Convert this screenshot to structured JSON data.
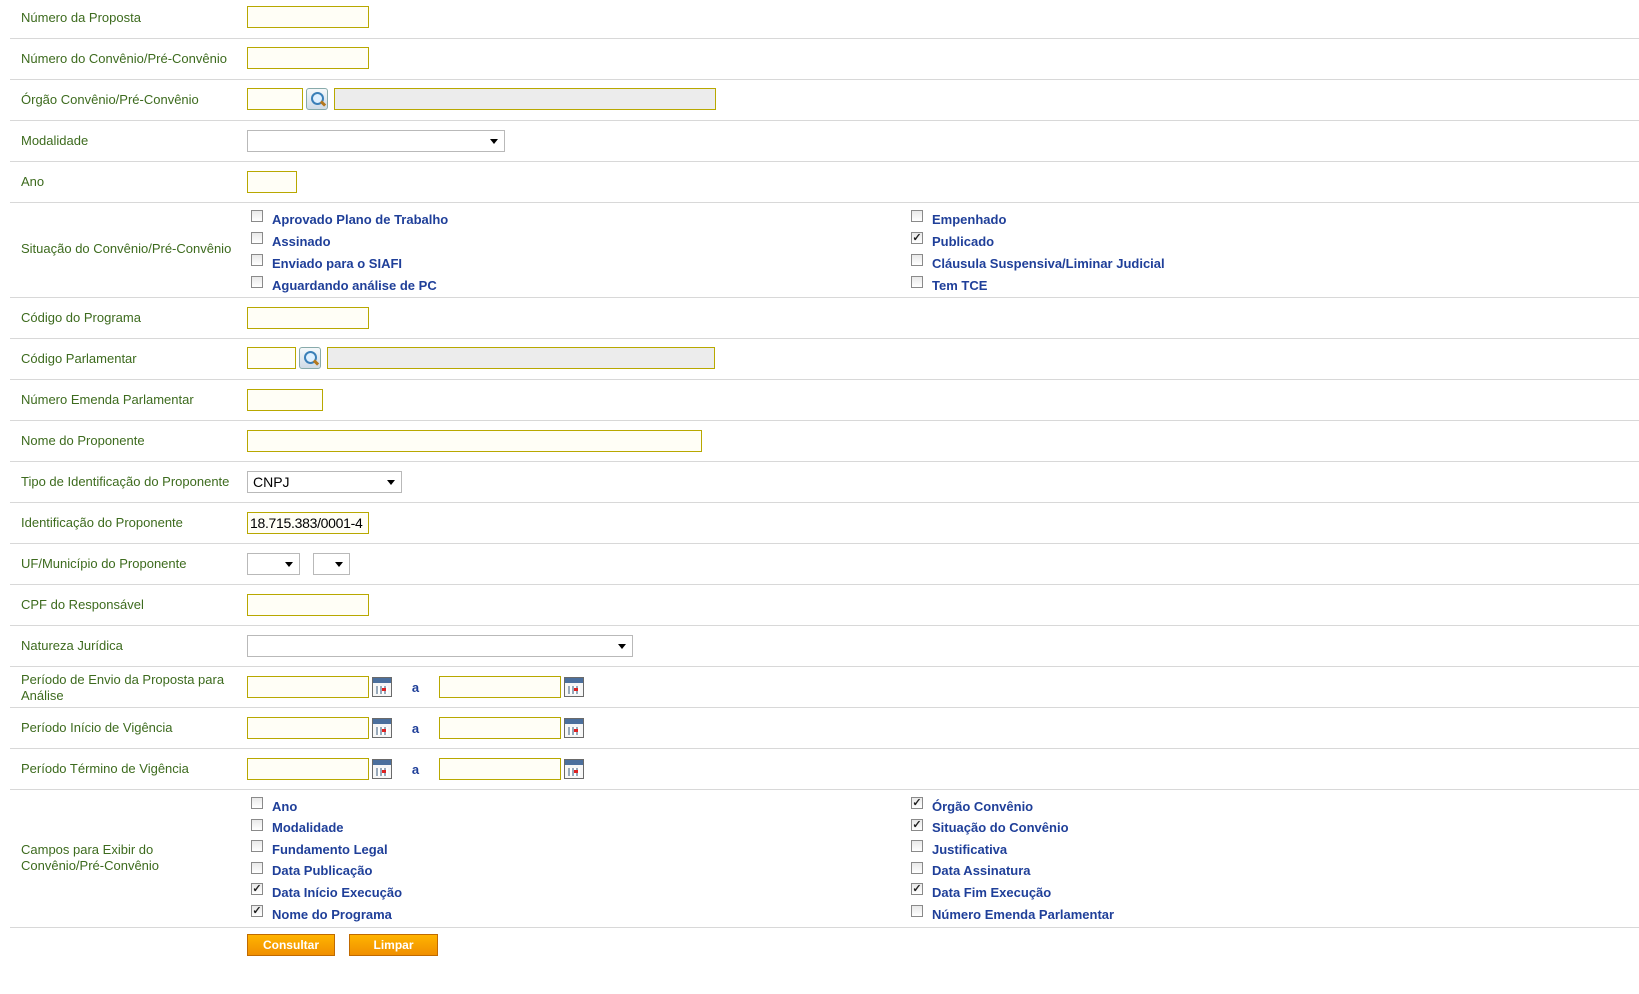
{
  "fields": {
    "numero_proposta": {
      "label": "Número da Proposta",
      "value": ""
    },
    "numero_convenio": {
      "label": "Número do Convênio/Pré-Convênio",
      "value": ""
    },
    "orgao": {
      "label": "Órgão Convênio/Pré-Convênio",
      "code": "",
      "name": ""
    },
    "modalidade": {
      "label": "Modalidade",
      "selected": ""
    },
    "ano": {
      "label": "Ano",
      "value": ""
    },
    "situacao": {
      "label": "Situação do Convênio/Pré-Convênio",
      "options": [
        {
          "label": "Aprovado Plano de Trabalho",
          "checked": false
        },
        {
          "label": "Assinado",
          "checked": false
        },
        {
          "label": "Enviado para o SIAFI",
          "checked": false
        },
        {
          "label": "Aguardando análise de PC",
          "checked": false
        },
        {
          "label": "Empenhado",
          "checked": false
        },
        {
          "label": "Publicado",
          "checked": true
        },
        {
          "label": "Cláusula Suspensiva/Liminar Judicial",
          "checked": false
        },
        {
          "label": "Tem TCE",
          "checked": false
        }
      ]
    },
    "codigo_programa": {
      "label": "Código do Programa",
      "value": ""
    },
    "codigo_parlamentar": {
      "label": "Código Parlamentar",
      "code": "",
      "name": ""
    },
    "numero_emenda": {
      "label": "Número Emenda Parlamentar",
      "value": ""
    },
    "nome_proponente": {
      "label": "Nome do Proponente",
      "value": ""
    },
    "tipo_identificacao": {
      "label": "Tipo de Identificação do Proponente",
      "selected": "CNPJ"
    },
    "identificacao": {
      "label": "Identificação do Proponente",
      "value": "18.715.383/0001-4"
    },
    "uf_municipio": {
      "label": "UF/Município do Proponente",
      "uf": "",
      "municipio": ""
    },
    "cpf_responsavel": {
      "label": "CPF do Responsável",
      "value": ""
    },
    "natureza_juridica": {
      "label": "Natureza Jurídica",
      "selected": ""
    },
    "periodo_envio": {
      "label": "Período de Envio da Proposta para Análise",
      "from": "",
      "to": "",
      "sep": "a"
    },
    "periodo_inicio": {
      "label": "Período Início de Vigência",
      "from": "",
      "to": "",
      "sep": "a"
    },
    "periodo_termino": {
      "label": "Período Término de Vigência",
      "from": "",
      "to": "",
      "sep": "a"
    },
    "campos_exibir": {
      "label": "Campos para Exibir do Convênio/Pré-Convênio",
      "options": [
        {
          "label": "Ano",
          "checked": false
        },
        {
          "label": "Modalidade",
          "checked": false
        },
        {
          "label": "Fundamento Legal",
          "checked": false
        },
        {
          "label": "Data Publicação",
          "checked": false
        },
        {
          "label": "Data Início Execução",
          "checked": true
        },
        {
          "label": "Nome do Programa",
          "checked": true
        },
        {
          "label": "Órgão Convênio",
          "checked": true
        },
        {
          "label": "Situação do Convênio",
          "checked": true
        },
        {
          "label": "Justificativa",
          "checked": false
        },
        {
          "label": "Data Assinatura",
          "checked": false
        },
        {
          "label": "Data Fim Execução",
          "checked": true
        },
        {
          "label": "Número Emenda Parlamentar",
          "checked": false
        }
      ]
    }
  },
  "buttons": {
    "consultar": "Consultar",
    "limpar": "Limpar"
  }
}
